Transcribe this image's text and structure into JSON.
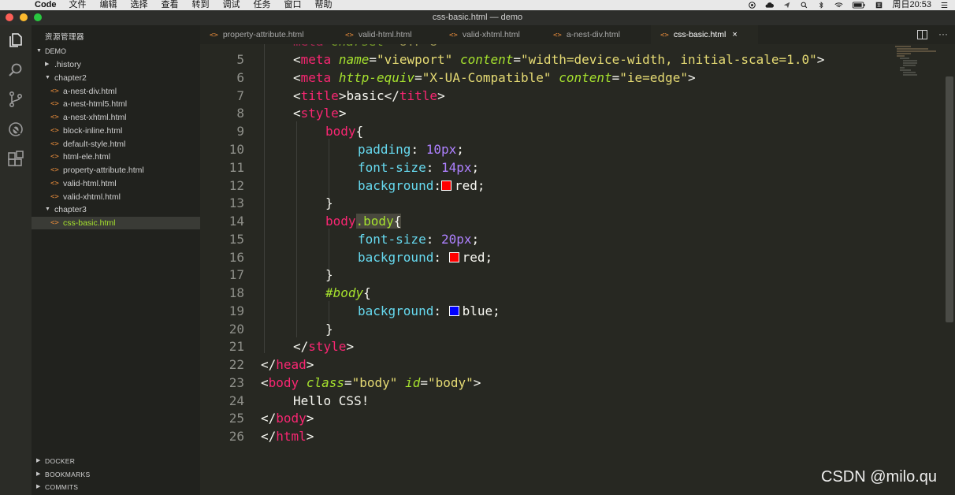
{
  "menubar": {
    "apple": "",
    "app": "Code",
    "items": [
      "文件",
      "编辑",
      "选择",
      "查看",
      "转到",
      "调试",
      "任务",
      "窗口",
      "帮助"
    ],
    "clock": "周日20:53"
  },
  "window": {
    "title": "css-basic.html — demo"
  },
  "sidebar": {
    "header": "资源管理器",
    "root": "DEMO",
    "tree": [
      {
        "label": ".history",
        "type": "folder",
        "depth": 1,
        "open": false
      },
      {
        "label": "chapter2",
        "type": "folder",
        "depth": 1,
        "open": true
      },
      {
        "label": "a-nest-div.html",
        "type": "file",
        "depth": 2
      },
      {
        "label": "a-nest-html5.html",
        "type": "file",
        "depth": 2
      },
      {
        "label": "a-nest-xhtml.html",
        "type": "file",
        "depth": 2
      },
      {
        "label": "block-inline.html",
        "type": "file",
        "depth": 2
      },
      {
        "label": "default-style.html",
        "type": "file",
        "depth": 2
      },
      {
        "label": "html-ele.html",
        "type": "file",
        "depth": 2
      },
      {
        "label": "property-attribute.html",
        "type": "file",
        "depth": 2
      },
      {
        "label": "valid-html.html",
        "type": "file",
        "depth": 2
      },
      {
        "label": "valid-xhtml.html",
        "type": "file",
        "depth": 2
      },
      {
        "label": "chapter3",
        "type": "folder",
        "depth": 1,
        "open": true
      },
      {
        "label": "css-basic.html",
        "type": "file",
        "depth": 2,
        "selected": true
      }
    ],
    "sections": [
      "DOCKER",
      "BOOKMARKS",
      "COMMITS"
    ]
  },
  "tabs": [
    {
      "label": "property-attribute.html",
      "active": false
    },
    {
      "label": "valid-html.html",
      "active": false
    },
    {
      "label": "valid-xhtml.html",
      "active": false
    },
    {
      "label": "a-nest-div.html",
      "active": false
    },
    {
      "label": "css-basic.html",
      "active": true,
      "close": "×"
    }
  ],
  "editor": {
    "line_numbers": [
      "5",
      "6",
      "7",
      "8",
      "9",
      "10",
      "11",
      "12",
      "13",
      "14",
      "15",
      "16",
      "17",
      "18",
      "19",
      "20",
      "21",
      "22",
      "23",
      "24",
      "25",
      "26"
    ],
    "swatch_colors": {
      "red": "#ff0000",
      "blue": "#0000ff"
    },
    "code": {
      "l5_tag": "meta",
      "l5_attr1": "name",
      "l5_val1": "\"viewport\"",
      "l5_attr2": "content",
      "l5_val2": "\"width=device-width, initial-scale=1.0\"",
      "l6_tag": "meta",
      "l6_attr1": "http-equiv",
      "l6_val1": "\"X-UA-Compatible\"",
      "l6_attr2": "content",
      "l6_val2": "\"ie=edge\"",
      "l7_tag": "title",
      "l7_text": "basic",
      "l8_tag": "style",
      "l9_sel": "body",
      "l10_prop": "padding",
      "l10_num": "10px",
      "l11_prop": "font-size",
      "l11_num": "14px",
      "l12_prop": "background",
      "l12_val": "red",
      "l14_sel1": "body",
      "l14_sel2": ".body",
      "l15_prop": "font-size",
      "l15_num": "20px",
      "l16_prop": "background",
      "l16_val": "red",
      "l18_sel": "#body",
      "l19_prop": "background",
      "l19_val": "blue",
      "l21_tag": "style",
      "l22_tag": "head",
      "l23_tag": "body",
      "l23_attr1": "class",
      "l23_val1": "\"body\"",
      "l23_attr2": "id",
      "l23_val2": "\"body\"",
      "l24_text": "Hello CSS!",
      "l25_tag": "body",
      "l26_tag": "html"
    }
  },
  "watermark": "CSDN @milo.qu"
}
